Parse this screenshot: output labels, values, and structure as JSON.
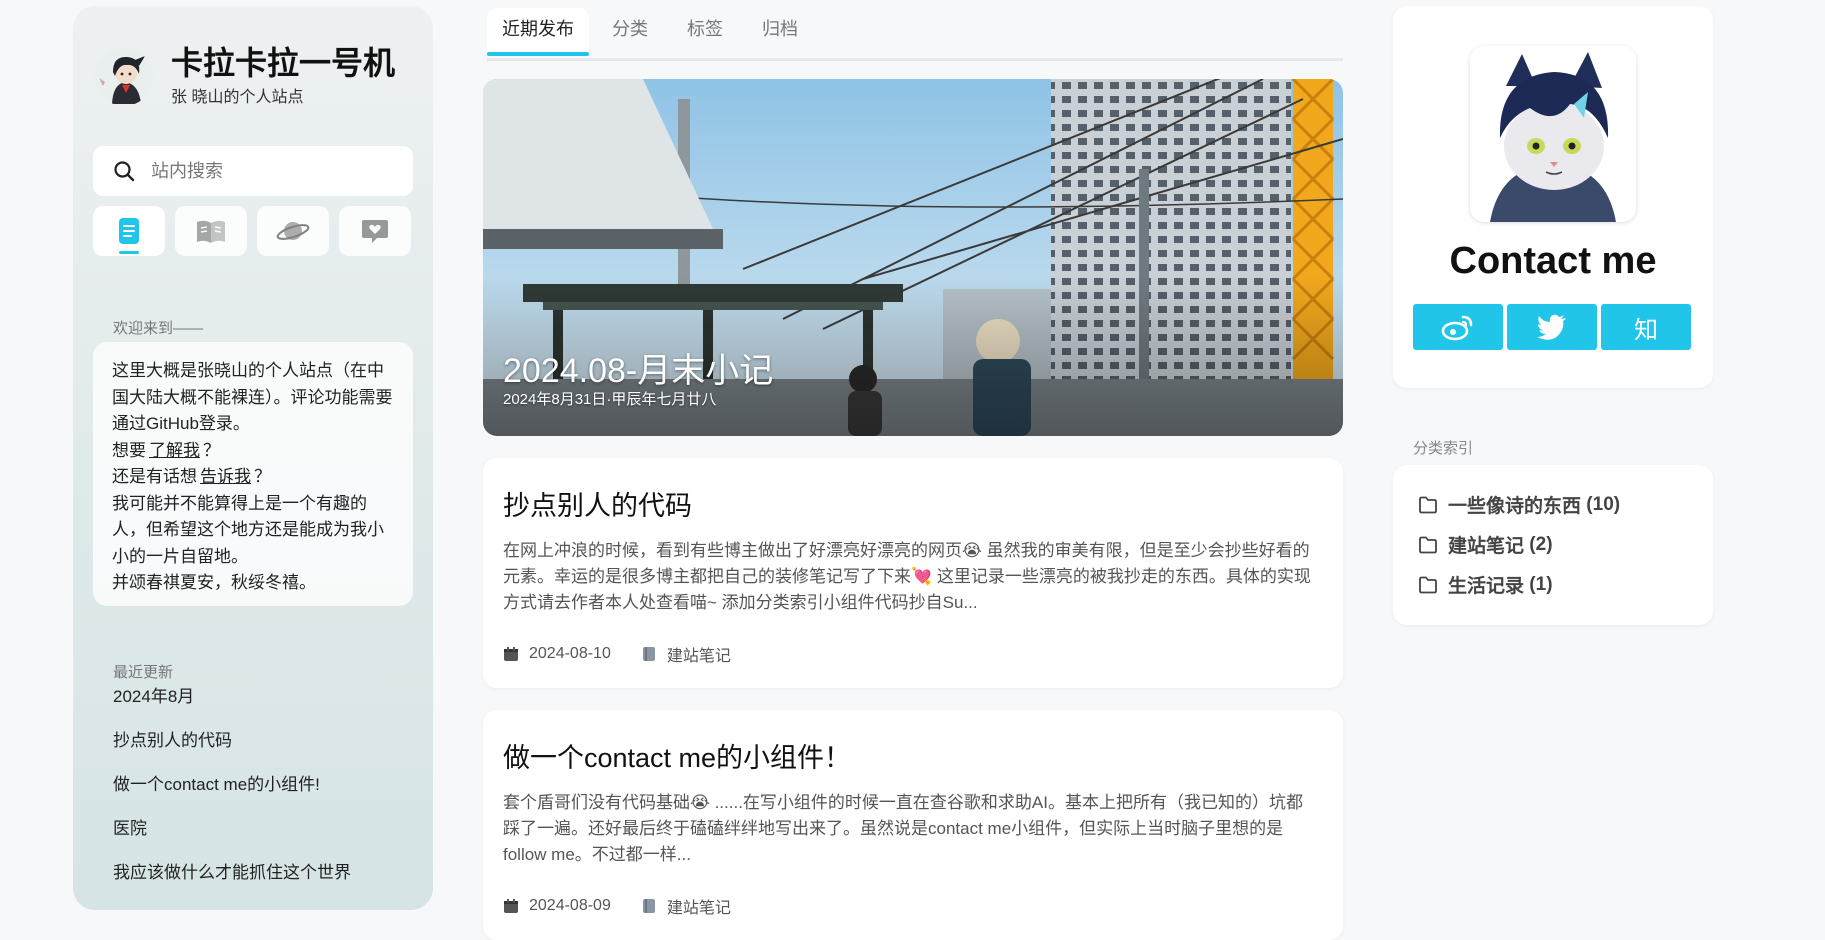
{
  "site": {
    "title": "卡拉卡拉一号机",
    "subtitle": "张 晓山的个人站点"
  },
  "search": {
    "placeholder": "站内搜索"
  },
  "sidebar_tabs": [
    {
      "icon": "notebook-icon",
      "active": true
    },
    {
      "icon": "open-book-icon",
      "active": false
    },
    {
      "icon": "planet-icon",
      "active": false
    },
    {
      "icon": "heart-message-icon",
      "active": false
    }
  ],
  "welcome": {
    "label": "欢迎来到——",
    "line1": "这里大概是张晓山的个人站点（在中国大陆大概不能裸连）。评论功能需要通过GitHub登录。",
    "line2_pre": "想要",
    "line2_link": "了解我",
    "line2_post": "？",
    "line3_pre": "还是有话想",
    "line3_link": "告诉我",
    "line3_post": "？",
    "line4": "我可能并不能算得上是一个有趣的人，但希望这个地方还是能成为我小小的一片自留地。",
    "line5": "并颂春祺夏安，秋绥冬禧。"
  },
  "recent": {
    "label": "最近更新",
    "items": [
      "2024年8月",
      "抄点别人的代码",
      "做一个contact me的小组件!",
      "医院",
      "我应该做什么才能抓住这个世界"
    ]
  },
  "tabs": [
    "近期发布",
    "分类",
    "标签",
    "归档"
  ],
  "hero": {
    "title": "2024.08-月末小记",
    "date": "2024年8月31日·甲辰年七月廿八"
  },
  "posts": [
    {
      "title": "抄点别人的代码",
      "excerpt": "在网上冲浪的时候，看到有些博主做出了好漂亮好漂亮的网页😭 虽然我的审美有限，但是至少会抄些好看的元素。幸运的是很多博主都把自己的装修笔记写了下来💘 这里记录一些漂亮的被我抄走的东西。具体的实现方式请去作者本人处查看喵~ 添加分类索引小组件代码抄自Su...",
      "date": "2024-08-10",
      "category": "建站笔记"
    },
    {
      "title": "做一个contact me的小组件！",
      "excerpt": "套个盾哥们没有代码基础😭 ......在写小组件的时候一直在查谷歌和求助AI。基本上把所有（我已知的）坑都踩了一遍。还好最后终于磕磕绊绊地写出来了。虽然说是contact me小组件，但实际上当时脑子里想的是follow me。不过都一样...",
      "date": "2024-08-09",
      "category": "建站笔记"
    }
  ],
  "contact": {
    "title": "Contact me",
    "socials": [
      {
        "icon": "weibo-icon",
        "label": ""
      },
      {
        "icon": "twitter-icon",
        "label": ""
      },
      {
        "icon": "zhihu-icon",
        "label": "知"
      }
    ]
  },
  "categories": {
    "label": "分类索引",
    "items": [
      {
        "name": "一些像诗的东西",
        "count": "(10)"
      },
      {
        "name": "建站笔记",
        "count": "(2)"
      },
      {
        "name": "生活记录",
        "count": "(1)"
      }
    ]
  },
  "colors": {
    "accent": "#21c5e9",
    "background": "#f6f8fa"
  }
}
